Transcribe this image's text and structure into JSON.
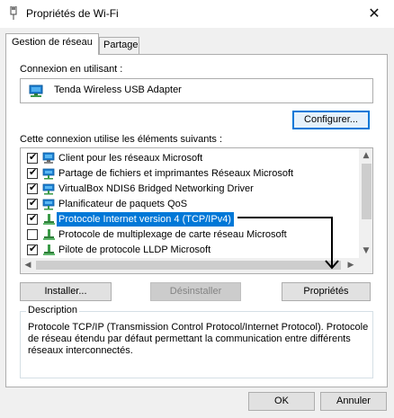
{
  "window": {
    "title": "Propriétés de Wi-Fi",
    "close_glyph": "✕"
  },
  "tabs": [
    {
      "label": "Gestion de réseau",
      "active": true
    },
    {
      "label": "Partage",
      "active": false
    }
  ],
  "connection": {
    "label": "Connexion en utilisant :",
    "adapter": "Tenda Wireless USB Adapter",
    "configure_button": "Configurer..."
  },
  "components": {
    "label": "Cette connexion utilise les éléments suivants :",
    "items": [
      {
        "label": "Client pour les réseaux Microsoft",
        "checked": true,
        "icon": "network-client-icon"
      },
      {
        "label": "Partage de fichiers et imprimantes Réseaux Microsoft",
        "checked": true,
        "icon": "network-service-icon"
      },
      {
        "label": "VirtualBox NDIS6 Bridged Networking Driver",
        "checked": true,
        "icon": "network-service-icon"
      },
      {
        "label": "Planificateur de paquets QoS",
        "checked": true,
        "icon": "network-service-icon"
      },
      {
        "label": "Protocole Internet version 4 (TCP/IPv4)",
        "checked": true,
        "selected": true,
        "icon": "protocol-icon"
      },
      {
        "label": "Protocole de multiplexage de carte réseau Microsoft",
        "checked": false,
        "icon": "protocol-icon"
      },
      {
        "label": "Pilote de protocole LLDP Microsoft",
        "checked": true,
        "icon": "protocol-icon"
      }
    ],
    "check_glyph": "✔"
  },
  "buttons": {
    "install": "Installer...",
    "uninstall": "Désinstaller",
    "properties": "Propriétés",
    "ok": "OK",
    "cancel": "Annuler"
  },
  "description": {
    "title": "Description",
    "text": "Protocole TCP/IP (Transmission Control Protocol/Internet Protocol). Protocole de réseau étendu par défaut permettant la communication entre différents réseaux interconnectés."
  },
  "colors": {
    "selection": "#0078d7",
    "annotation_arrow": "#000000"
  }
}
